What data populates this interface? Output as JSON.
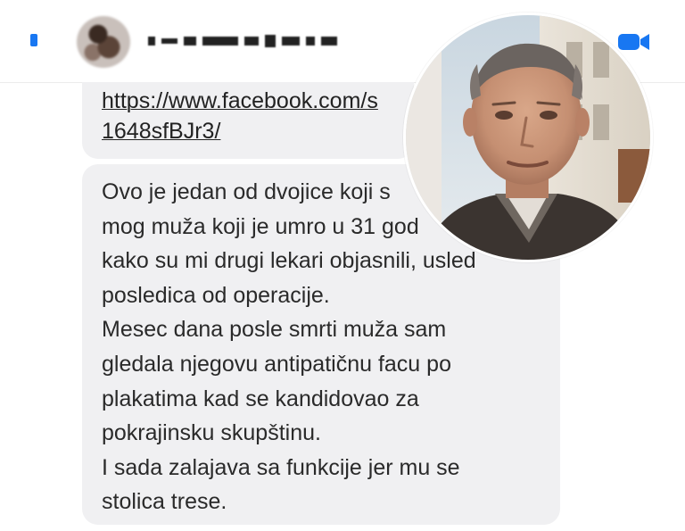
{
  "header": {
    "back_icon": "chevron-left-icon",
    "contact_avatar": "blurred-avatar",
    "contact_name": "",
    "video_icon": "video-camera-icon",
    "accent_color": "#1877f2"
  },
  "messages": {
    "link_text": "https://www.facebook.com/s\n1648sfBJr3/",
    "body_text": "Ovo je jedan od dvojice koji s\nmog muža koji je umro u 31 god\nkako su mi drugi lekari objasnili,  usled\nposledica od operacije.\nMesec dana posle smrti muža sam\ngledala njegovu antipatičnu facu po\nplakatima kad se kandidovao za\npokrajinsku skupštinu.\nI sada zalajava sa funkcije jer mu se\nstolica trese."
  },
  "overlay": {
    "photo": "portrait-photo"
  }
}
